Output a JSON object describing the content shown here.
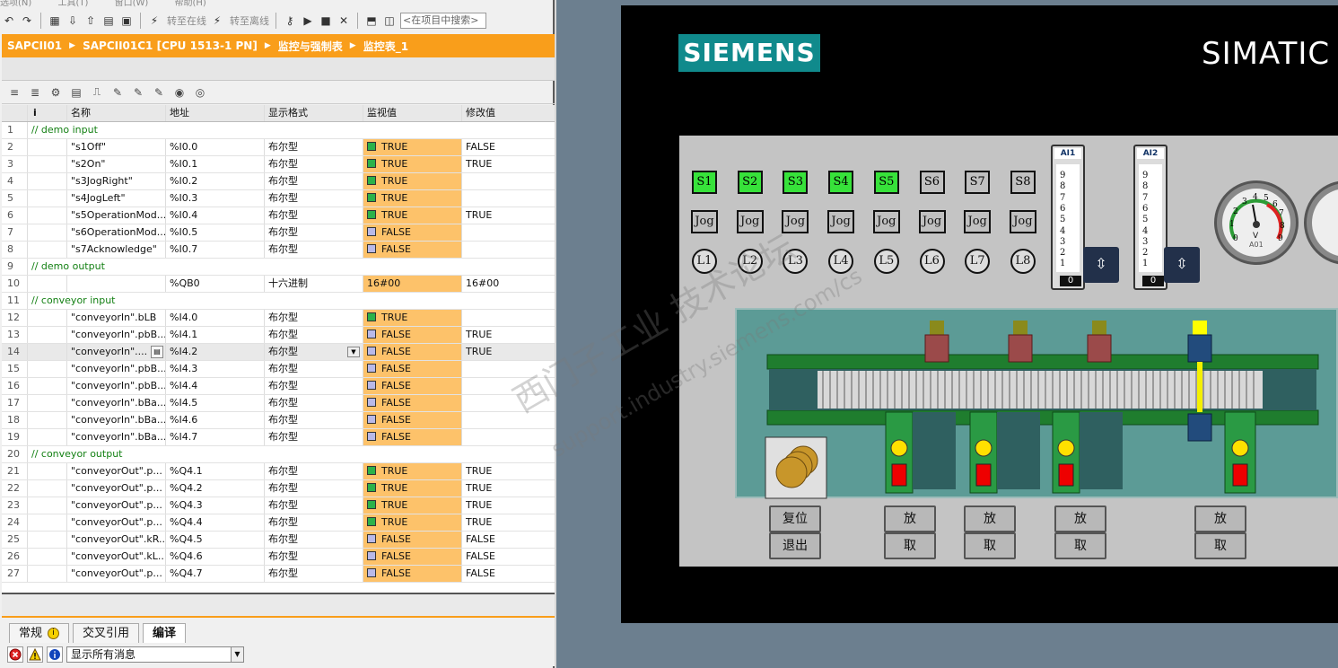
{
  "menu": [
    "选项(N)",
    "工具(T)",
    "窗口(W)",
    "帮助(H)"
  ],
  "toolbar": {
    "go_online": "转至在线",
    "go_offline": "转至离线",
    "search_placeholder": "<在项目中搜索>"
  },
  "breadcrumb": [
    "SAPCII01",
    "SAPCII01C1 [CPU 1513-1 PN]",
    "监控与强制表",
    "监控表_1"
  ],
  "table": {
    "headers": {
      "info": "i",
      "name": "名称",
      "address": "地址",
      "format": "显示格式",
      "monitor": "监视值",
      "modify": "修改值"
    },
    "rows": [
      {
        "n": "1",
        "comment": "// demo input"
      },
      {
        "n": "2",
        "name": "\"s1Off\"",
        "addr": "%I0.0",
        "fmt": "布尔型",
        "mon": "TRUE",
        "mod": "FALSE"
      },
      {
        "n": "3",
        "name": "\"s2On\"",
        "addr": "%I0.1",
        "fmt": "布尔型",
        "mon": "TRUE",
        "mod": "TRUE"
      },
      {
        "n": "4",
        "name": "\"s3JogRight\"",
        "addr": "%I0.2",
        "fmt": "布尔型",
        "mon": "TRUE",
        "mod": ""
      },
      {
        "n": "5",
        "name": "\"s4JogLeft\"",
        "addr": "%I0.3",
        "fmt": "布尔型",
        "mon": "TRUE",
        "mod": ""
      },
      {
        "n": "6",
        "name": "\"s5OperationMod...",
        "addr": "%I0.4",
        "fmt": "布尔型",
        "mon": "TRUE",
        "mod": "TRUE"
      },
      {
        "n": "7",
        "name": "\"s6OperationMod...",
        "addr": "%I0.5",
        "fmt": "布尔型",
        "mon": "FALSE",
        "mod": ""
      },
      {
        "n": "8",
        "name": "\"s7Acknowledge\"",
        "addr": "%I0.7",
        "fmt": "布尔型",
        "mon": "FALSE",
        "mod": ""
      },
      {
        "n": "9",
        "comment": "// demo output"
      },
      {
        "n": "10",
        "name": "",
        "addr": "%QB0",
        "fmt": "十六进制",
        "mon": "16#00",
        "mod": "16#00"
      },
      {
        "n": "11",
        "comment": "// conveyor input"
      },
      {
        "n": "12",
        "name": "\"conveyorIn\".bLB",
        "addr": "%I4.0",
        "fmt": "布尔型",
        "mon": "TRUE",
        "mod": ""
      },
      {
        "n": "13",
        "name": "\"conveyorIn\".pbB...",
        "addr": "%I4.1",
        "fmt": "布尔型",
        "mon": "FALSE",
        "mod": "TRUE"
      },
      {
        "n": "14",
        "name": "\"conveyorIn\"....",
        "addr": "%I4.2",
        "fmt": "布尔型",
        "mon": "FALSE",
        "mod": "TRUE"
      },
      {
        "n": "15",
        "name": "\"conveyorIn\".pbB...",
        "addr": "%I4.3",
        "fmt": "布尔型",
        "mon": "FALSE",
        "mod": ""
      },
      {
        "n": "16",
        "name": "\"conveyorIn\".pbB...",
        "addr": "%I4.4",
        "fmt": "布尔型",
        "mon": "FALSE",
        "mod": ""
      },
      {
        "n": "17",
        "name": "\"conveyorIn\".bBa...",
        "addr": "%I4.5",
        "fmt": "布尔型",
        "mon": "FALSE",
        "mod": ""
      },
      {
        "n": "18",
        "name": "\"conveyorIn\".bBa...",
        "addr": "%I4.6",
        "fmt": "布尔型",
        "mon": "FALSE",
        "mod": ""
      },
      {
        "n": "19",
        "name": "\"conveyorIn\".bBa...",
        "addr": "%I4.7",
        "fmt": "布尔型",
        "mon": "FALSE",
        "mod": ""
      },
      {
        "n": "20",
        "comment": "// conveyor output"
      },
      {
        "n": "21",
        "name": "\"conveyorOut\".p...",
        "addr": "%Q4.1",
        "fmt": "布尔型",
        "mon": "TRUE",
        "mod": "TRUE"
      },
      {
        "n": "22",
        "name": "\"conveyorOut\".p...",
        "addr": "%Q4.2",
        "fmt": "布尔型",
        "mon": "TRUE",
        "mod": "TRUE"
      },
      {
        "n": "23",
        "name": "\"conveyorOut\".p...",
        "addr": "%Q4.3",
        "fmt": "布尔型",
        "mon": "TRUE",
        "mod": "TRUE"
      },
      {
        "n": "24",
        "name": "\"conveyorOut\".p...",
        "addr": "%Q4.4",
        "fmt": "布尔型",
        "mon": "TRUE",
        "mod": "TRUE"
      },
      {
        "n": "25",
        "name": "\"conveyorOut\".kR...",
        "addr": "%Q4.5",
        "fmt": "布尔型",
        "mon": "FALSE",
        "mod": "FALSE"
      },
      {
        "n": "26",
        "name": "\"conveyorOut\".kL...",
        "addr": "%Q4.6",
        "fmt": "布尔型",
        "mon": "FALSE",
        "mod": "FALSE"
      },
      {
        "n": "27",
        "name": "\"conveyorOut\".p...",
        "addr": "%Q4.7",
        "fmt": "布尔型",
        "mon": "FALSE",
        "mod": "FALSE"
      }
    ]
  },
  "bottom_tabs": [
    "常规",
    "交叉引用",
    "编译"
  ],
  "message_filter": "显示所有消息",
  "hmi": {
    "brand": "SIEMENS",
    "product": "SIMATIC",
    "s_buttons": [
      "S1",
      "S2",
      "S3",
      "S4",
      "S5",
      "S6",
      "S7",
      "S8"
    ],
    "s_on": [
      true,
      true,
      true,
      true,
      true,
      false,
      false,
      false
    ],
    "jog_label": "Jog",
    "lamps": [
      "L1",
      "L2",
      "L3",
      "L4",
      "L5",
      "L6",
      "L7",
      "L8"
    ],
    "ai1": {
      "title": "AI1",
      "scale": [
        "9",
        "8",
        "7",
        "6",
        "5",
        "4",
        "3",
        "2",
        "1"
      ],
      "value": "0"
    },
    "ai2": {
      "title": "AI2",
      "scale": [
        "9",
        "8",
        "7",
        "6",
        "5",
        "4",
        "3",
        "2",
        "1"
      ],
      "value": "0"
    },
    "dial": {
      "unit": "V",
      "name": "A01"
    },
    "reset": "复位",
    "exit": "退出",
    "put": "放",
    "take": "取"
  },
  "watermark": [
    "西门子工业 技术论坛",
    "support.industry.siemens.com/cs"
  ]
}
